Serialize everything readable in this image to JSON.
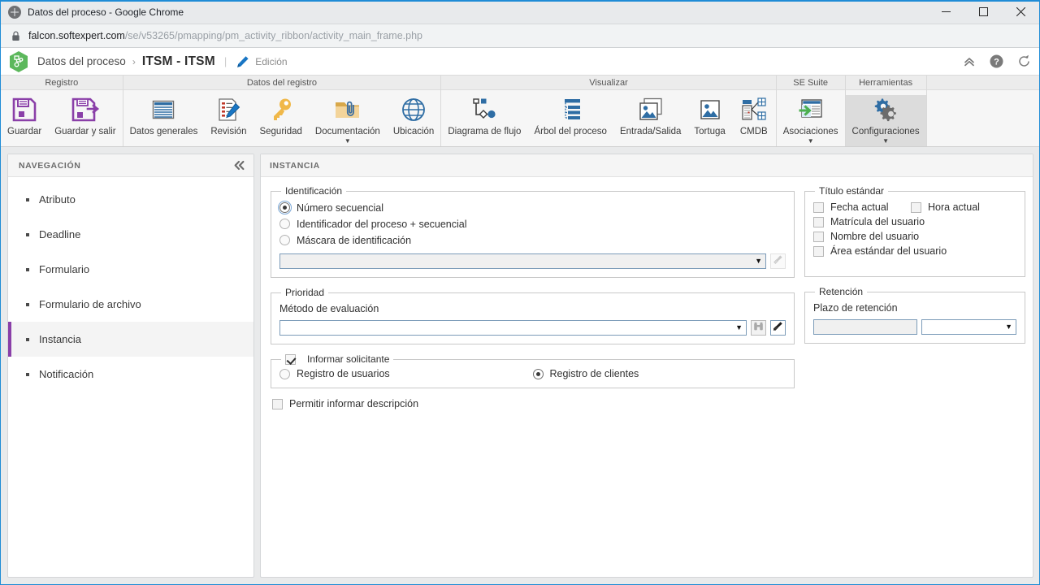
{
  "window": {
    "title": "Datos del proceso - Google Chrome",
    "favicon": "globe-icon",
    "minimize_label": "Minimizar",
    "maximize_label": "Maximizar",
    "close_label": "Cerrar"
  },
  "browser": {
    "url_host": "falcon.softexpert.com",
    "url_path": "/se/v53265/pmapping/pm_activity_ribbon/activity_main_frame.php",
    "lock_icon": "lock-icon"
  },
  "header": {
    "breadcrumb_root": "Datos del proceso",
    "breadcrumb_separator": "›",
    "breadcrumb_current": "ITSM - ITSM",
    "divider": "|",
    "mode_label": "Edición",
    "mode_icon": "pencil-icon",
    "actions": [
      {
        "name": "collapse-ribbon",
        "icon": "chevron-double-up-icon"
      },
      {
        "name": "help",
        "icon": "question-circle-icon"
      },
      {
        "name": "refresh",
        "icon": "refresh-icon"
      }
    ]
  },
  "ribbon": {
    "groups": [
      {
        "title": "Registro",
        "items": [
          {
            "label": "Guardar",
            "icon": "save-icon",
            "caret": false,
            "selected": false
          },
          {
            "label": "Guardar y salir",
            "icon": "save-exit-icon",
            "caret": false,
            "selected": false
          }
        ]
      },
      {
        "title": "Datos del registro",
        "items": [
          {
            "label": "Datos generales",
            "icon": "general-data-icon",
            "caret": false,
            "selected": false
          },
          {
            "label": "Revisión",
            "icon": "revision-icon",
            "caret": false,
            "selected": false
          },
          {
            "label": "Seguridad",
            "icon": "key-icon",
            "caret": false,
            "selected": false
          },
          {
            "label": "Documentación",
            "icon": "folder-clip-icon",
            "caret": true,
            "selected": false
          },
          {
            "label": "Ubicación",
            "icon": "globe-icon",
            "caret": false,
            "selected": false
          }
        ]
      },
      {
        "title": "Visualizar",
        "items": [
          {
            "label": "Diagrama de flujo",
            "icon": "flowchart-icon",
            "caret": false,
            "selected": false
          },
          {
            "label": "Árbol del proceso",
            "icon": "tree-icon",
            "caret": false,
            "selected": false
          },
          {
            "label": "Entrada/Salida",
            "icon": "images-icon",
            "caret": false,
            "selected": false
          },
          {
            "label": "Tortuga",
            "icon": "image-icon",
            "caret": false,
            "selected": false
          },
          {
            "label": "CMDB",
            "icon": "cmdb-icon",
            "caret": false,
            "selected": false
          }
        ]
      },
      {
        "title": "SE Suite",
        "items": [
          {
            "label": "Asociaciones",
            "icon": "associations-icon",
            "caret": true,
            "selected": false
          }
        ]
      },
      {
        "title": "Herramientas",
        "items": [
          {
            "label": "Configuraciones",
            "icon": "gears-icon",
            "caret": true,
            "selected": true
          }
        ]
      },
      {
        "title": "",
        "items": []
      }
    ]
  },
  "sidebar": {
    "title": "NAVEGACIÓN",
    "collapse_icon": "chevron-double-left-icon",
    "items": [
      {
        "label": "Atributo",
        "active": false
      },
      {
        "label": "Deadline",
        "active": false
      },
      {
        "label": "Formulario",
        "active": false
      },
      {
        "label": "Formulario de archivo",
        "active": false
      },
      {
        "label": "Instancia",
        "active": true
      },
      {
        "label": "Notificación",
        "active": false
      }
    ]
  },
  "main": {
    "title": "INSTANCIA",
    "identificacion": {
      "legend": "Identificación",
      "options": [
        {
          "label": "Número secuencial",
          "checked": true
        },
        {
          "label": "Identificador del proceso + secuencial",
          "checked": false
        },
        {
          "label": "Máscara de identificación",
          "checked": false
        }
      ],
      "mask_select_value": "",
      "mask_caret": "▼",
      "clear_button_icon": "brush-icon"
    },
    "prioridad": {
      "legend": "Prioridad",
      "field_label": "Método de evaluación",
      "select_value": "",
      "caret": "▼",
      "search_button_icon": "binoculars-icon",
      "clear_button_icon": "brush-icon"
    },
    "informar_solicitante": {
      "legend": "Informar solicitante",
      "legend_checked": true,
      "options": [
        {
          "label": "Registro de usuarios",
          "checked": false
        },
        {
          "label": "Registro de clientes",
          "checked": true
        }
      ]
    },
    "permitir_informar_descripcion": {
      "label": "Permitir informar descripción",
      "checked": false
    },
    "titulo_estandar": {
      "legend": "Título estándar",
      "rows": [
        [
          {
            "label": "Fecha actual",
            "checked": false
          },
          {
            "label": "Hora actual",
            "checked": false
          }
        ],
        [
          {
            "label": "Matrícula del usuario",
            "checked": false
          }
        ],
        [
          {
            "label": "Nombre del usuario",
            "checked": false
          }
        ],
        [
          {
            "label": "Área estándar del usuario",
            "checked": false
          }
        ]
      ]
    },
    "retencion": {
      "legend": "Retención",
      "field_label": "Plazo de retención",
      "text_value": "",
      "select_value": "",
      "caret": "▼"
    }
  },
  "colors": {
    "chrome_accent": "#1f8cd6",
    "save_purple": "#8a3fa8",
    "icon_blue": "#2e6da4",
    "key_yellow": "#f0b849",
    "active_marker": "#8a3fa8",
    "logo_green": "#5cb85c"
  }
}
